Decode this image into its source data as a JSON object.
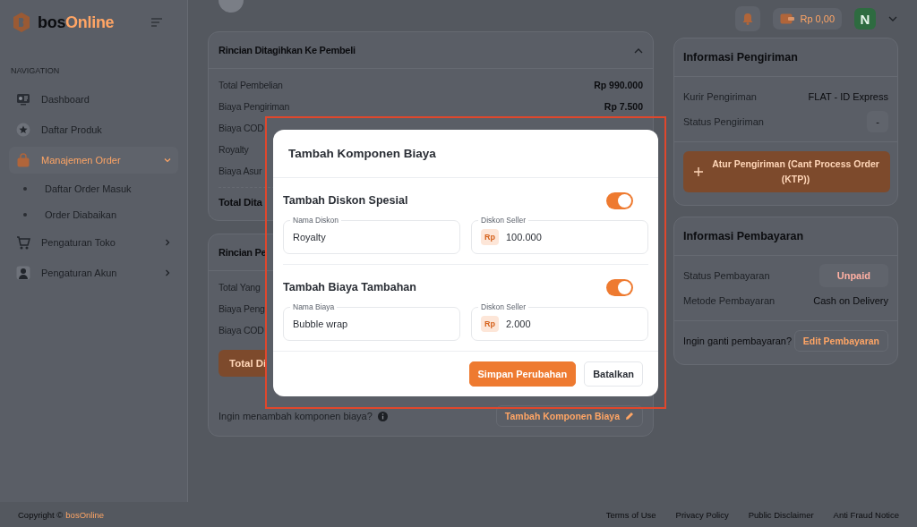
{
  "sidebar": {
    "logo": {
      "lead": "bos",
      "accent": "Online"
    },
    "section_label": "NAVIGATION",
    "items": [
      {
        "label": "Dashboard",
        "selected": false
      },
      {
        "label": "Daftar Produk",
        "selected": false
      },
      {
        "label": "Manajemen Order",
        "selected": true,
        "expanded": true,
        "children": [
          {
            "label": "Daftar Order Masuk",
            "selected": false
          },
          {
            "label": "Order Diabaikan",
            "selected": false
          }
        ]
      },
      {
        "label": "Pengaturan Toko",
        "selected": false,
        "expanded": false
      },
      {
        "label": "Pengaturan Akun",
        "selected": false,
        "expanded": false
      }
    ]
  },
  "header": {
    "wallet": "Rp 0,00",
    "avatar": "N"
  },
  "billing": {
    "title": "Rincian Ditagihkan Ke Pembeli",
    "expanded": true,
    "rows": [
      {
        "label": "Total Pembelian",
        "value": "Rp 990.000"
      },
      {
        "label": "Biaya Pengiriman",
        "value": "Rp 7.500"
      },
      {
        "label": "Biaya COD"
      },
      {
        "label": "Royalty"
      },
      {
        "label": "Biaya Asur"
      }
    ],
    "total": "Total Dita"
  },
  "payout": {
    "title": "Rincian Pe",
    "rows": [
      {
        "label": "Total Yang"
      },
      {
        "label": "Biaya Peng"
      },
      {
        "label": "Biaya COD"
      }
    ],
    "total": "Total Di",
    "add_prompt": "Ingin menambah komponen biaya?",
    "add_button": "Tambah Komponen Biaya"
  },
  "shipping": {
    "title": "Informasi Pengiriman",
    "rows": [
      {
        "label": "Kurir Pengiriman",
        "value": "FLAT - ID Express",
        "kind": "text"
      },
      {
        "label": "Status Pengiriman",
        "value": "-",
        "kind": "badge"
      }
    ],
    "button": "Atur Pengiriman (Cant Process Order (KTP))"
  },
  "payment": {
    "title": "Informasi Pembayaran",
    "rows": [
      {
        "label": "Status Pembayaran",
        "value": "Unpaid",
        "kind": "badge"
      },
      {
        "label": "Metode Pembayaran",
        "value": "Cash on Delivery",
        "kind": "text"
      }
    ],
    "change_prompt": "Ingin ganti pembayaran?",
    "change_button": "Edit Pembayaran"
  },
  "modal": {
    "title": "Tambah Komponen Biaya",
    "sections": [
      {
        "title": "Tambah Diskon Spesial",
        "on": true,
        "name_field": {
          "label": "Nama Diskon",
          "value": "Royalty"
        },
        "amount_field": {
          "label": "Diskon Seller",
          "prefix": "Rp",
          "value": "100.000"
        }
      },
      {
        "title": "Tambah Biaya Tambahan",
        "on": true,
        "name_field": {
          "label": "Nama Biaya",
          "value": "Bubble wrap"
        },
        "amount_field": {
          "label": "Diskon Seller",
          "prefix": "Rp",
          "value": "2.000"
        }
      }
    ],
    "buttons": [
      {
        "label": "Simpan Perubahan",
        "kind": "primary"
      },
      {
        "label": "Batalkan",
        "kind": "secondary"
      }
    ]
  },
  "footer": {
    "copyright": "Copyright ©",
    "brand": "bosOnline",
    "links": [
      "Terms of Use",
      "Privacy Policy",
      "Public Disclaimer",
      "Anti Fraud Notice"
    ]
  }
}
